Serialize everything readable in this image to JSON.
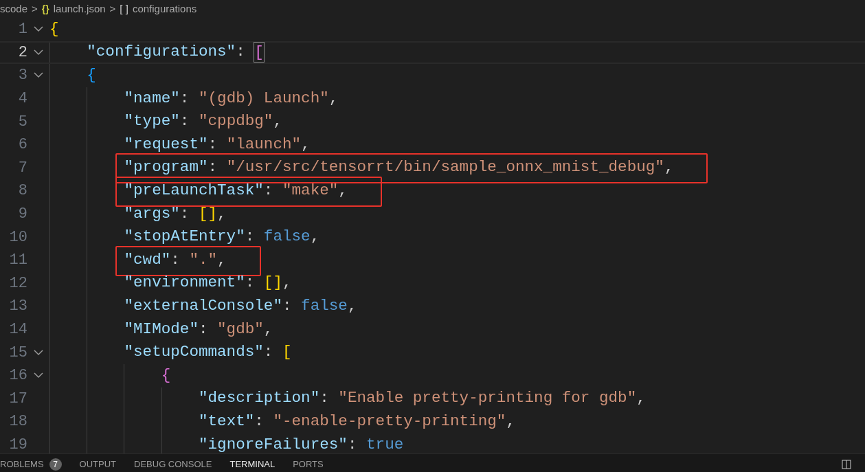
{
  "breadcrumb": [
    {
      "kind": "text",
      "text": "scode"
    },
    {
      "kind": "sep",
      "text": ">"
    },
    {
      "kind": "icon",
      "text": "{}"
    },
    {
      "kind": "text",
      "text": "launch.json"
    },
    {
      "kind": "sep",
      "text": ">"
    },
    {
      "kind": "icon",
      "text": "[ ]"
    },
    {
      "kind": "text",
      "text": "configurations"
    }
  ],
  "lines": [
    {
      "number": "1",
      "fold": true,
      "current": false,
      "boxed": false,
      "tokens": [
        {
          "kind": "bracket",
          "text": "{",
          "color": "#ffd700"
        }
      ],
      "children": [
        {
          "number": "2",
          "fold": true,
          "current": true,
          "boxed": false,
          "tokens": [
            {
              "kind": "key",
              "text": "\"configurations\""
            },
            {
              "kind": "punct",
              "text": ": "
            },
            {
              "kind": "bracket",
              "text": "[",
              "color": "#da70d6",
              "matched": true
            }
          ]
        },
        {
          "number": "3",
          "fold": true,
          "current": false,
          "boxed": false,
          "tokens": [
            {
              "kind": "bracket",
              "text": "{",
              "color": "#179fff"
            }
          ],
          "children": [
            {
              "number": "4",
              "fold": false,
              "current": false,
              "boxed": false,
              "tokens": [
                {
                  "kind": "key",
                  "text": "\"name\""
                },
                {
                  "kind": "punct",
                  "text": ": "
                },
                {
                  "kind": "string",
                  "text": "\"(gdb) Launch\""
                },
                {
                  "kind": "punct",
                  "text": ","
                }
              ]
            },
            {
              "number": "5",
              "fold": false,
              "current": false,
              "boxed": false,
              "tokens": [
                {
                  "kind": "key",
                  "text": "\"type\""
                },
                {
                  "kind": "punct",
                  "text": ": "
                },
                {
                  "kind": "string",
                  "text": "\"cppdbg\""
                },
                {
                  "kind": "punct",
                  "text": ","
                }
              ]
            },
            {
              "number": "6",
              "fold": false,
              "current": false,
              "boxed": false,
              "tokens": [
                {
                  "kind": "key",
                  "text": "\"request\""
                },
                {
                  "kind": "punct",
                  "text": ": "
                },
                {
                  "kind": "string",
                  "text": "\"launch\""
                },
                {
                  "kind": "punct",
                  "text": ","
                }
              ]
            },
            {
              "number": "7",
              "fold": false,
              "current": false,
              "boxed": true,
              "tokens": [
                {
                  "kind": "key",
                  "text": "\"program\""
                },
                {
                  "kind": "punct",
                  "text": ": "
                },
                {
                  "kind": "string",
                  "text": "\"/usr/src/tensorrt/bin/sample_onnx_mnist_debug\""
                },
                {
                  "kind": "punct",
                  "text": ","
                }
              ]
            },
            {
              "number": "8",
              "fold": false,
              "current": false,
              "boxed": true,
              "tokens": [
                {
                  "kind": "key",
                  "text": "\"preLaunchTask\""
                },
                {
                  "kind": "punct",
                  "text": ": "
                },
                {
                  "kind": "string",
                  "text": "\"make\""
                },
                {
                  "kind": "punct",
                  "text": ","
                }
              ]
            },
            {
              "number": "9",
              "fold": false,
              "current": false,
              "boxed": false,
              "tokens": [
                {
                  "kind": "key",
                  "text": "\"args\""
                },
                {
                  "kind": "punct",
                  "text": ": "
                },
                {
                  "kind": "bracket",
                  "text": "[]",
                  "color": "#ffd700"
                },
                {
                  "kind": "punct",
                  "text": ","
                }
              ]
            },
            {
              "number": "10",
              "fold": false,
              "current": false,
              "boxed": false,
              "tokens": [
                {
                  "kind": "key",
                  "text": "\"stopAtEntry\""
                },
                {
                  "kind": "punct",
                  "text": ": "
                },
                {
                  "kind": "keyword",
                  "text": "false"
                },
                {
                  "kind": "punct",
                  "text": ","
                }
              ]
            },
            {
              "number": "11",
              "fold": false,
              "current": false,
              "boxed": true,
              "tokens": [
                {
                  "kind": "key",
                  "text": "\"cwd\""
                },
                {
                  "kind": "punct",
                  "text": ": "
                },
                {
                  "kind": "string",
                  "text": "\".\""
                },
                {
                  "kind": "punct",
                  "text": ","
                }
              ]
            },
            {
              "number": "12",
              "fold": false,
              "current": false,
              "boxed": false,
              "tokens": [
                {
                  "kind": "key",
                  "text": "\"environment\""
                },
                {
                  "kind": "punct",
                  "text": ": "
                },
                {
                  "kind": "bracket",
                  "text": "[]",
                  "color": "#ffd700"
                },
                {
                  "kind": "punct",
                  "text": ","
                }
              ]
            },
            {
              "number": "13",
              "fold": false,
              "current": false,
              "boxed": false,
              "tokens": [
                {
                  "kind": "key",
                  "text": "\"externalConsole\""
                },
                {
                  "kind": "punct",
                  "text": ": "
                },
                {
                  "kind": "keyword",
                  "text": "false"
                },
                {
                  "kind": "punct",
                  "text": ","
                }
              ]
            },
            {
              "number": "14",
              "fold": false,
              "current": false,
              "boxed": false,
              "tokens": [
                {
                  "kind": "key",
                  "text": "\"MIMode\""
                },
                {
                  "kind": "punct",
                  "text": ": "
                },
                {
                  "kind": "string",
                  "text": "\"gdb\""
                },
                {
                  "kind": "punct",
                  "text": ","
                }
              ]
            },
            {
              "number": "15",
              "fold": true,
              "current": false,
              "boxed": false,
              "tokens": [
                {
                  "kind": "key",
                  "text": "\"setupCommands\""
                },
                {
                  "kind": "punct",
                  "text": ": "
                },
                {
                  "kind": "bracket",
                  "text": "[",
                  "color": "#ffd700"
                }
              ],
              "children": [
                {
                  "number": "16",
                  "fold": true,
                  "current": false,
                  "boxed": false,
                  "tokens": [
                    {
                      "kind": "bracket",
                      "text": "{",
                      "color": "#da70d6"
                    }
                  ],
                  "children": [
                    {
                      "number": "17",
                      "fold": false,
                      "current": false,
                      "boxed": false,
                      "tokens": [
                        {
                          "kind": "key",
                          "text": "\"description\""
                        },
                        {
                          "kind": "punct",
                          "text": ": "
                        },
                        {
                          "kind": "string",
                          "text": "\"Enable pretty-printing for gdb\""
                        },
                        {
                          "kind": "punct",
                          "text": ","
                        }
                      ]
                    },
                    {
                      "number": "18",
                      "fold": false,
                      "current": false,
                      "boxed": false,
                      "tokens": [
                        {
                          "kind": "key",
                          "text": "\"text\""
                        },
                        {
                          "kind": "punct",
                          "text": ": "
                        },
                        {
                          "kind": "string",
                          "text": "\"-enable-pretty-printing\""
                        },
                        {
                          "kind": "punct",
                          "text": ","
                        }
                      ]
                    },
                    {
                      "number": "19",
                      "fold": false,
                      "current": false,
                      "boxed": false,
                      "tokens": [
                        {
                          "kind": "key",
                          "text": "\"ignoreFailures\""
                        },
                        {
                          "kind": "punct",
                          "text": ": "
                        },
                        {
                          "kind": "keyword",
                          "text": "true"
                        }
                      ]
                    }
                  ]
                }
              ]
            }
          ]
        }
      ]
    }
  ],
  "panel_tabs": [
    {
      "label": "ROBLEMS",
      "badge": "7",
      "selected": false
    },
    {
      "label": "OUTPUT",
      "selected": false
    },
    {
      "label": "DEBUG CONSOLE",
      "selected": false
    },
    {
      "label": "TERMINAL",
      "selected": true
    },
    {
      "label": "PORTS",
      "selected": false
    }
  ]
}
